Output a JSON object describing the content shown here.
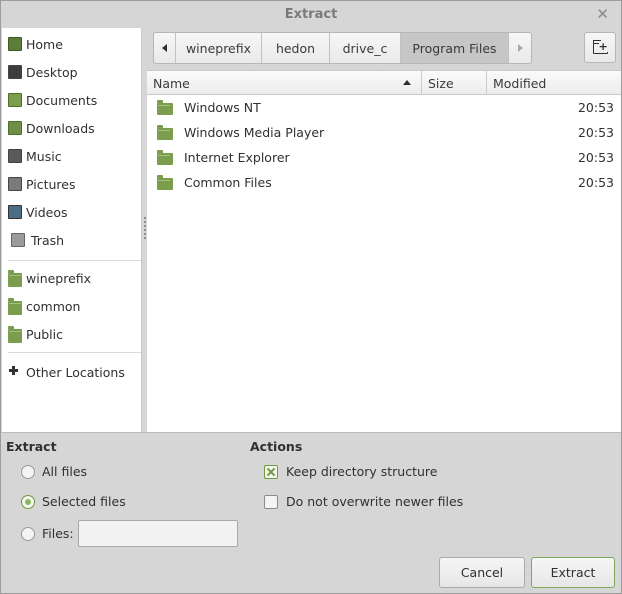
{
  "window": {
    "title": "Extract"
  },
  "sidebar": {
    "places": [
      {
        "label": "Home",
        "icon": "home-icon"
      },
      {
        "label": "Desktop",
        "icon": "desktop-icon"
      },
      {
        "label": "Documents",
        "icon": "documents-icon"
      },
      {
        "label": "Downloads",
        "icon": "downloads-icon"
      },
      {
        "label": "Music",
        "icon": "music-icon"
      },
      {
        "label": "Pictures",
        "icon": "pictures-icon"
      },
      {
        "label": "Videos",
        "icon": "videos-icon"
      },
      {
        "label": "Trash",
        "icon": "trash-icon"
      }
    ],
    "bookmarks": [
      {
        "label": "wineprefix",
        "icon": "folder-icon"
      },
      {
        "label": "common",
        "icon": "folder-icon"
      },
      {
        "label": "Public",
        "icon": "folder-icon"
      }
    ],
    "other": {
      "label": "Other Locations",
      "icon": "plus-icon"
    }
  },
  "pathbar": {
    "segments": [
      "wineprefix",
      "hedon",
      "drive_c",
      "Program Files"
    ],
    "active": "Program Files"
  },
  "filelist": {
    "columns": {
      "name": "Name",
      "size": "Size",
      "modified": "Modified"
    },
    "rows": [
      {
        "name": "Windows NT",
        "size": "",
        "modified": "20:53"
      },
      {
        "name": "Windows Media Player",
        "size": "",
        "modified": "20:53"
      },
      {
        "name": "Internet Explorer",
        "size": "",
        "modified": "20:53"
      },
      {
        "name": "Common Files",
        "size": "",
        "modified": "20:53"
      }
    ]
  },
  "extract": {
    "title": "Extract",
    "all_files": "All files",
    "selected_files": "Selected files",
    "files": "Files:",
    "files_value": "",
    "selected": "selected_files"
  },
  "actions": {
    "title": "Actions",
    "keep_structure": "Keep directory structure",
    "keep_structure_checked": true,
    "no_overwrite": "Do not overwrite newer files",
    "no_overwrite_checked": false
  },
  "buttons": {
    "cancel": "Cancel",
    "extract": "Extract"
  },
  "colors": {
    "accent": "#8cb65d",
    "folder": "#7a9e4e"
  }
}
